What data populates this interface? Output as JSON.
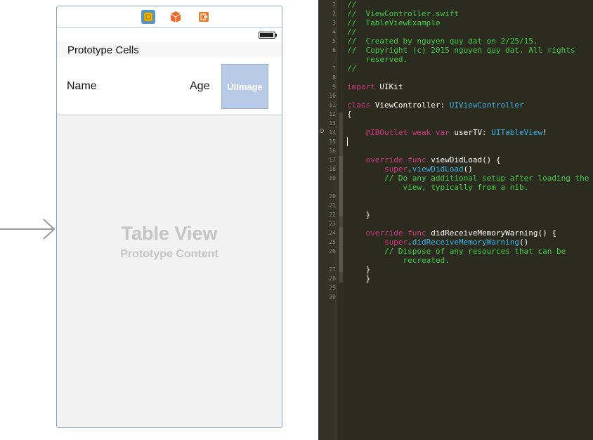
{
  "storyboard": {
    "dock": {
      "icons": [
        "view-controller-icon",
        "first-responder-icon",
        "exit-icon"
      ]
    },
    "section_header": "Prototype Cells",
    "cell": {
      "name": "Name",
      "age": "Age",
      "image": "UIImage"
    },
    "table_placeholder": {
      "title": "Table View",
      "subtitle": "Prototype Content"
    }
  },
  "editor": {
    "lines": [
      {
        "n": "1",
        "parts": [
          {
            "t": "//",
            "c": "cmt"
          }
        ]
      },
      {
        "n": "2",
        "parts": [
          {
            "t": "//  ViewController.swift",
            "c": "cmt"
          }
        ]
      },
      {
        "n": "3",
        "parts": [
          {
            "t": "//  TableViewExample",
            "c": "cmt"
          }
        ]
      },
      {
        "n": "4",
        "parts": [
          {
            "t": "//",
            "c": "cmt"
          }
        ]
      },
      {
        "n": "5",
        "parts": [
          {
            "t": "//  Created by nguyen quy dat on 2/25/15.",
            "c": "cmt"
          }
        ]
      },
      {
        "n": "6",
        "parts": [
          {
            "t": "//  Copyright (c) 2015 nguyen quy dat. All rights",
            "c": "cmt"
          }
        ]
      },
      {
        "n": "",
        "parts": [
          {
            "t": "    reserved.",
            "c": "cmt"
          }
        ]
      },
      {
        "n": "7",
        "parts": [
          {
            "t": "//",
            "c": "cmt"
          }
        ]
      },
      {
        "n": "8",
        "parts": []
      },
      {
        "n": "9",
        "parts": [
          {
            "t": "import",
            "c": "kw"
          },
          {
            "t": " UIKit",
            "c": "pl"
          }
        ]
      },
      {
        "n": "10",
        "parts": []
      },
      {
        "n": "11",
        "parts": [
          {
            "t": "class",
            "c": "kw"
          },
          {
            "t": " ViewController: ",
            "c": "pl"
          },
          {
            "t": "UIViewController",
            "c": "ty"
          }
        ]
      },
      {
        "n": "12",
        "parts": [
          {
            "t": "{",
            "c": "pl"
          }
        ]
      },
      {
        "n": "13",
        "parts": []
      },
      {
        "n": "14",
        "parts": [
          {
            "t": "    @IBOutlet weak var",
            "c": "kw"
          },
          {
            "t": " userTV: ",
            "c": "pl"
          },
          {
            "t": "UITableView",
            "c": "ty"
          },
          {
            "t": "!",
            "c": "pl"
          }
        ]
      },
      {
        "n": "15",
        "parts": []
      },
      {
        "n": "16",
        "parts": []
      },
      {
        "n": "17",
        "parts": [
          {
            "t": "    override func",
            "c": "kw"
          },
          {
            "t": " viewDidLoad() {",
            "c": "pl"
          }
        ]
      },
      {
        "n": "18",
        "parts": [
          {
            "t": "        super",
            "c": "kw"
          },
          {
            "t": ".",
            "c": "pl"
          },
          {
            "t": "viewDidLoad",
            "c": "ty"
          },
          {
            "t": "()",
            "c": "pl"
          }
        ]
      },
      {
        "n": "19",
        "parts": [
          {
            "t": "        // Do any additional setup after loading the",
            "c": "cmt"
          }
        ]
      },
      {
        "n": "",
        "parts": [
          {
            "t": "            view, typically from a nib.",
            "c": "cmt"
          }
        ]
      },
      {
        "n": "20",
        "parts": []
      },
      {
        "n": "21",
        "parts": []
      },
      {
        "n": "22",
        "parts": [
          {
            "t": "    }",
            "c": "pl"
          }
        ]
      },
      {
        "n": "23",
        "parts": []
      },
      {
        "n": "24",
        "parts": [
          {
            "t": "    override func",
            "c": "kw"
          },
          {
            "t": " didReceiveMemoryWarning() {",
            "c": "pl"
          }
        ]
      },
      {
        "n": "25",
        "parts": [
          {
            "t": "        super",
            "c": "kw"
          },
          {
            "t": ".",
            "c": "pl"
          },
          {
            "t": "didReceiveMemoryWarning",
            "c": "ty"
          },
          {
            "t": "()",
            "c": "pl"
          }
        ]
      },
      {
        "n": "26",
        "parts": [
          {
            "t": "        // Dispose of any resources that can be",
            "c": "cmt"
          }
        ]
      },
      {
        "n": "",
        "parts": [
          {
            "t": "            recreated.",
            "c": "cmt"
          }
        ]
      },
      {
        "n": "27",
        "parts": [
          {
            "t": "    }",
            "c": "pl"
          }
        ]
      },
      {
        "n": "28",
        "parts": [
          {
            "t": "    }",
            "c": "pl"
          }
        ]
      },
      {
        "n": "29",
        "parts": []
      },
      {
        "n": "30",
        "parts": []
      }
    ]
  },
  "colors": {
    "comment": "#41cc45",
    "keyword": "#d33682",
    "type": "#3ab0e2",
    "editor_bg": "#2b2b1f",
    "placeholder_text": "#c4c4c4"
  }
}
